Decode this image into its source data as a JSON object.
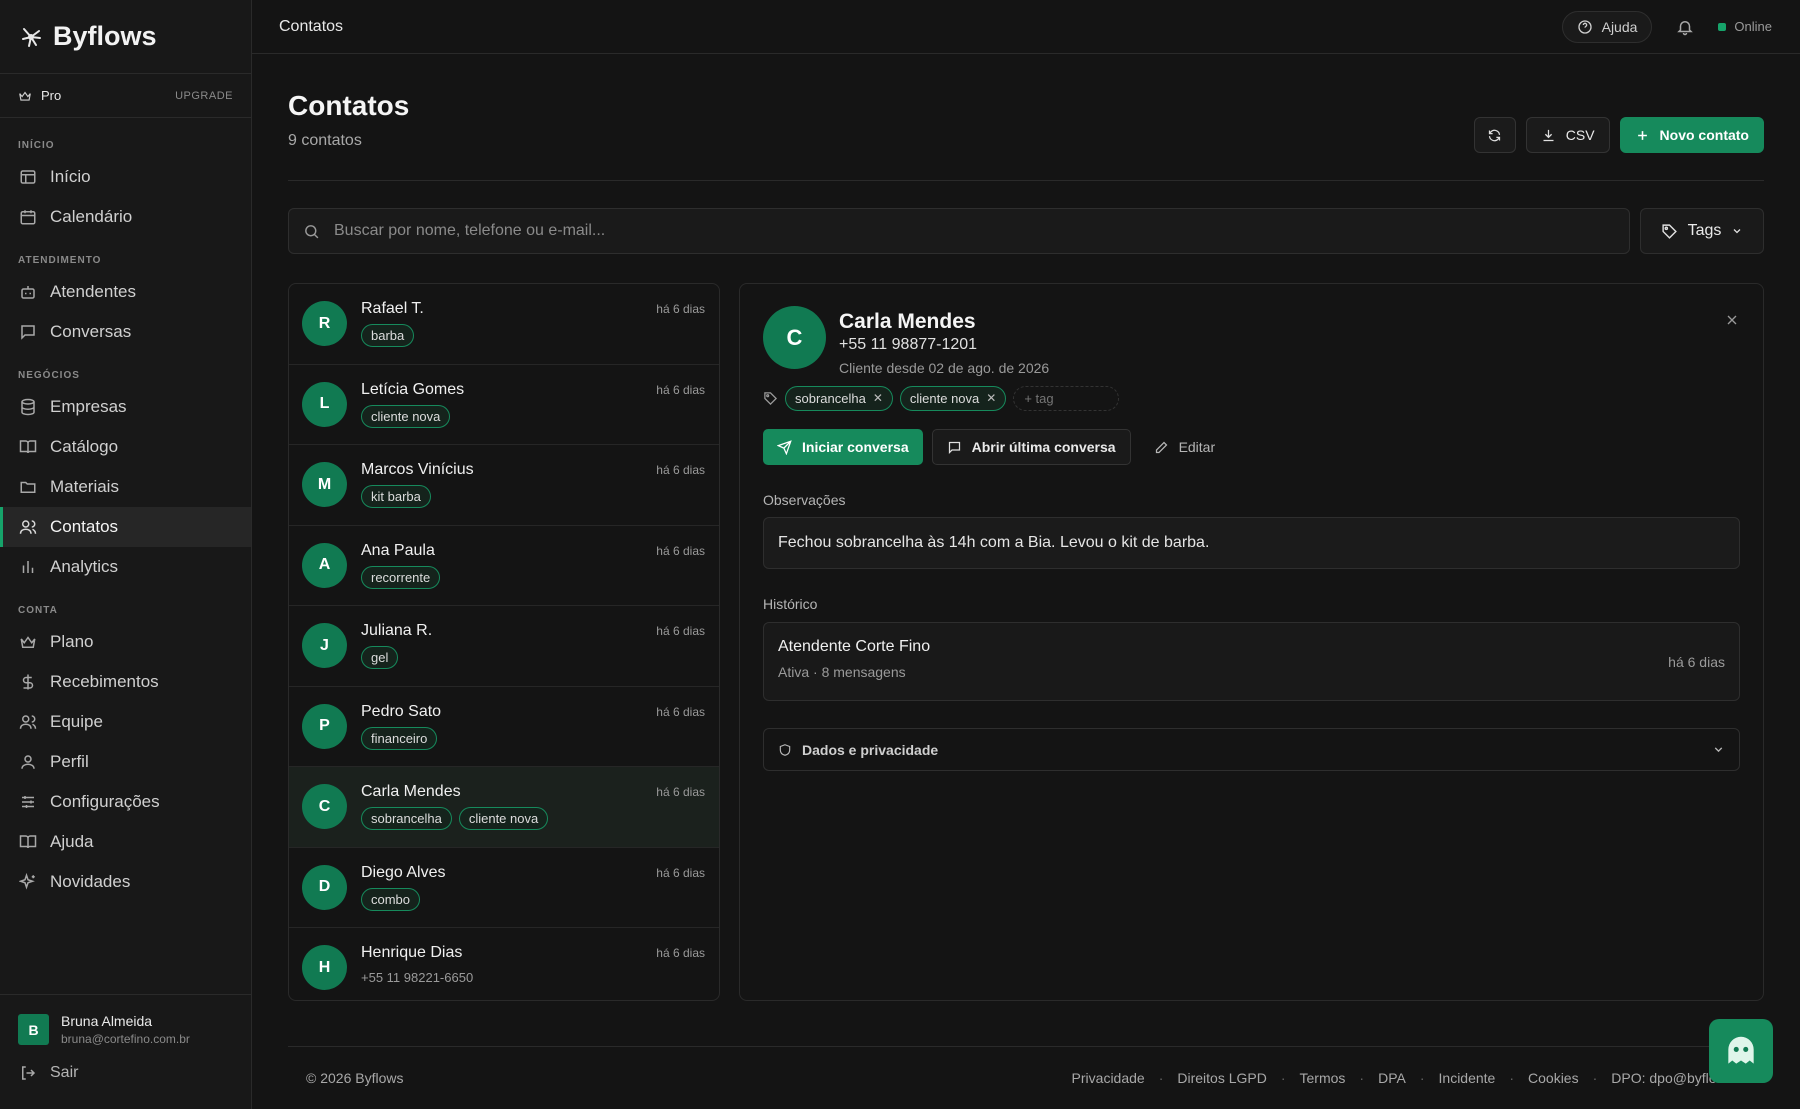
{
  "brand": {
    "name": "Byflows"
  },
  "plan": {
    "label": "Pro",
    "upgrade": "UPGRADE"
  },
  "nav": {
    "sections": [
      {
        "title": "INÍCIO",
        "items": [
          {
            "label": "Início"
          },
          {
            "label": "Calendário"
          }
        ]
      },
      {
        "title": "ATENDIMENTO",
        "items": [
          {
            "label": "Atendentes"
          },
          {
            "label": "Conversas"
          }
        ]
      },
      {
        "title": "NEGÓCIOS",
        "items": [
          {
            "label": "Empresas"
          },
          {
            "label": "Catálogo"
          },
          {
            "label": "Materiais"
          },
          {
            "label": "Contatos"
          },
          {
            "label": "Analytics"
          }
        ]
      },
      {
        "title": "CONTA",
        "items": [
          {
            "label": "Plano"
          },
          {
            "label": "Recebimentos"
          },
          {
            "label": "Equipe"
          },
          {
            "label": "Perfil"
          },
          {
            "label": "Configurações"
          },
          {
            "label": "Ajuda"
          },
          {
            "label": "Novidades"
          }
        ]
      }
    ]
  },
  "user": {
    "initial": "B",
    "name": "Bruna Almeida",
    "email": "bruna@cortefino.com.br",
    "logout": "Sair"
  },
  "topbar": {
    "title": "Contatos",
    "help": "Ajuda",
    "status": "Online"
  },
  "page": {
    "title": "Contatos",
    "subtitle": "9 contatos",
    "csv_label": "CSV",
    "new_label": "Novo contato",
    "search_placeholder": "Buscar por nome, telefone ou e-mail...",
    "tags_label": "Tags"
  },
  "contacts": [
    {
      "initial": "R",
      "name": "Rafael T.",
      "time": "há 6 dias",
      "tags": [
        "barba"
      ]
    },
    {
      "initial": "L",
      "name": "Letícia Gomes",
      "time": "há 6 dias",
      "tags": [
        "cliente nova"
      ]
    },
    {
      "initial": "M",
      "name": "Marcos Vinícius",
      "time": "há 6 dias",
      "tags": [
        "kit barba"
      ]
    },
    {
      "initial": "A",
      "name": "Ana Paula",
      "time": "há 6 dias",
      "tags": [
        "recorrente"
      ]
    },
    {
      "initial": "J",
      "name": "Juliana R.",
      "time": "há 6 dias",
      "tags": [
        "gel"
      ]
    },
    {
      "initial": "P",
      "name": "Pedro Sato",
      "time": "há 6 dias",
      "tags": [
        "financeiro"
      ]
    },
    {
      "initial": "C",
      "name": "Carla Mendes",
      "time": "há 6 dias",
      "tags": [
        "sobrancelha",
        "cliente nova"
      ]
    },
    {
      "initial": "D",
      "name": "Diego Alves",
      "time": "há 6 dias",
      "tags": [
        "combo"
      ]
    },
    {
      "initial": "H",
      "name": "Henrique Dias",
      "time": "há 6 dias",
      "phone": "+55 11 98221-6650"
    }
  ],
  "detail": {
    "initial": "C",
    "name": "Carla Mendes",
    "phone": "+55 11 98877-1201",
    "since": "Cliente desde 02 de ago. de 2026",
    "tags": [
      "sobrancelha",
      "cliente nova"
    ],
    "tag_placeholder": "+ tag",
    "start_chat": "Iniciar conversa",
    "open_last": "Abrir última conversa",
    "edit": "Editar",
    "notes_label": "Observações",
    "notes": "Fechou sobrancelha às 14h com a Bia. Levou o kit de barba.",
    "history_label": "Histórico",
    "history": {
      "title": "Atendente Corte Fino",
      "meta": "Ativa · 8 mensagens",
      "time": "há 6 dias"
    },
    "privacy": "Dados e privacidade"
  },
  "footer": {
    "copyright": "© 2026 Byflows",
    "links": [
      "Privacidade",
      "Direitos LGPD",
      "Termos",
      "DPA",
      "Incidente",
      "Cookies",
      "DPO: dpo@byflows.com"
    ]
  },
  "colors": {
    "accent": "#168a5c",
    "avatar": "#117a52",
    "background": "#141414"
  }
}
